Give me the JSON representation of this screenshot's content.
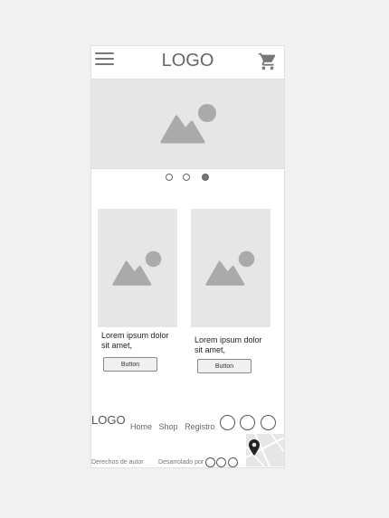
{
  "header": {
    "logo": "LOGO",
    "menu_icon": "hamburger-menu-icon",
    "cart_icon": "shopping-cart-icon"
  },
  "hero": {
    "image_icon": "image-placeholder-icon"
  },
  "carousel": {
    "dots": 3,
    "active_index": 2
  },
  "products": [
    {
      "description": "Lorem ipsum dolor sit amet,",
      "button": "Button"
    },
    {
      "description": "Lorem ipsum dolor sit amet,",
      "button": "Button"
    }
  ],
  "footer": {
    "logo": "LOGO",
    "nav": [
      "Home",
      "Shop",
      "Registro"
    ],
    "copyright": "Derechos de autor",
    "developed_by": "Desarrolado por",
    "map_icon": "map-pin-icon"
  },
  "colors": {
    "placeholder_bg": "#e6e6e6",
    "placeholder_shape": "#aaaaaa",
    "page_bg": "#f1f1f1"
  }
}
